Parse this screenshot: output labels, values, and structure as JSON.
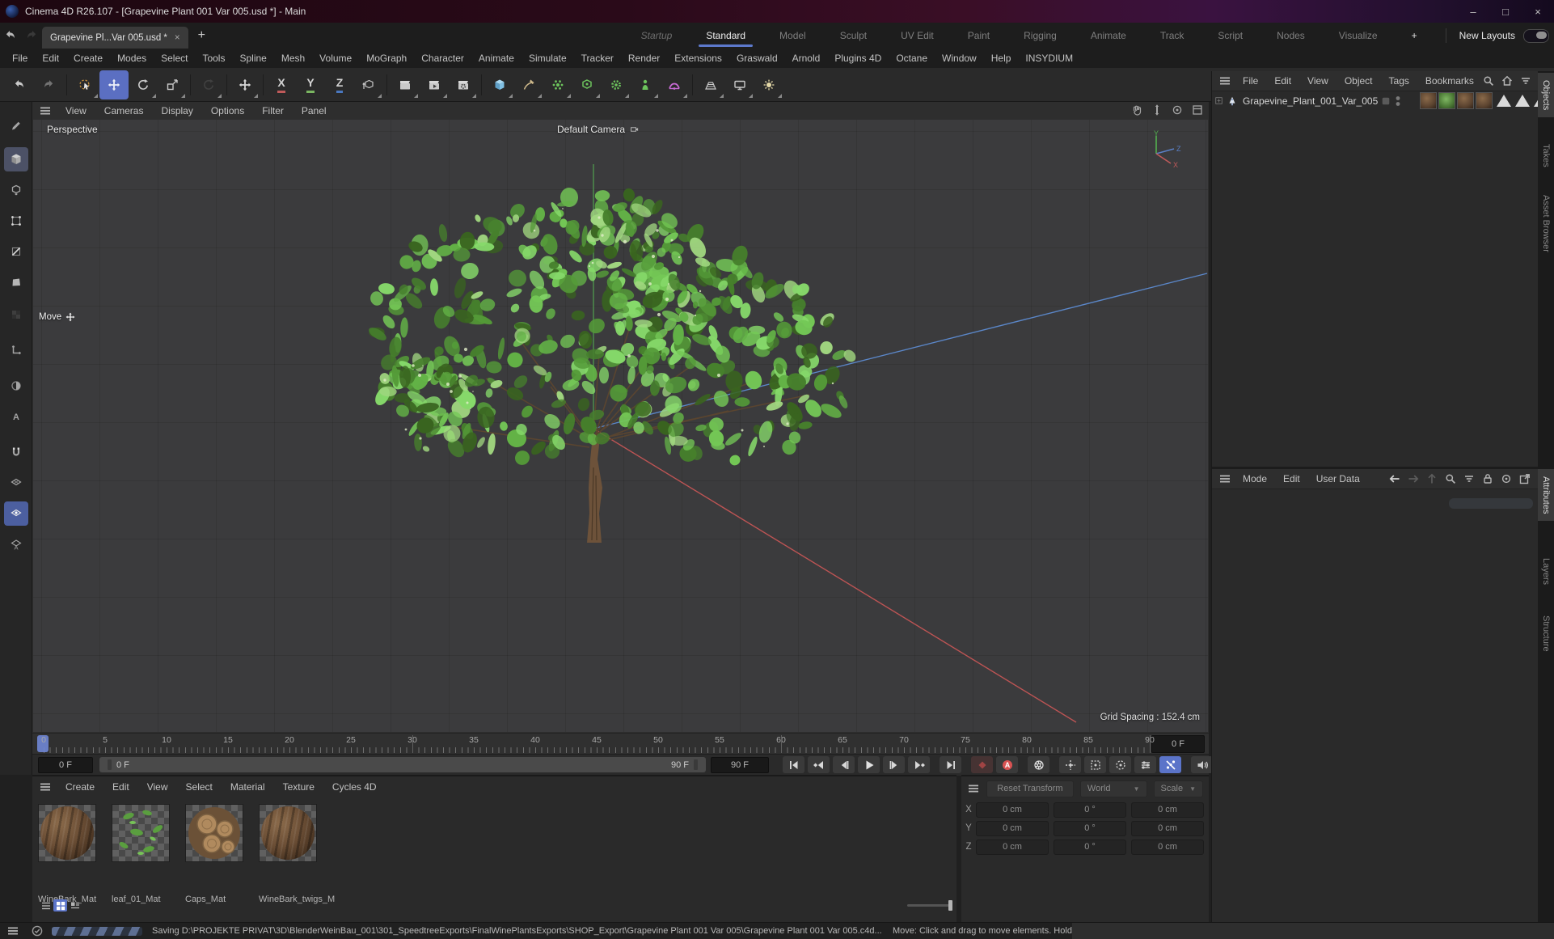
{
  "window": {
    "title": "Cinema 4D R26.107 - [Grapevine Plant 001 Var 005.usd *] - Main",
    "controls": {
      "minimize": "–",
      "maximize": "□",
      "close": "×"
    }
  },
  "document_tabs": {
    "active_tab": "Grapevine Pl...Var 005.usd *",
    "close_glyph": "×",
    "add_tab": "+"
  },
  "layout_tabs": {
    "items": [
      "Startup",
      "Standard",
      "Model",
      "Sculpt",
      "UV Edit",
      "Paint",
      "Rigging",
      "Animate",
      "Track",
      "Script",
      "Nodes",
      "Visualize"
    ],
    "active": "Standard",
    "italic": "Startup",
    "add_button": "+",
    "new_layouts_label": "New Layouts"
  },
  "menu_bar": [
    "File",
    "Edit",
    "Create",
    "Modes",
    "Select",
    "Tools",
    "Spline",
    "Mesh",
    "Volume",
    "MoGraph",
    "Character",
    "Animate",
    "Simulate",
    "Tracker",
    "Render",
    "Extensions",
    "Graswald",
    "Arnold",
    "Plugins 4D",
    "Octane",
    "Window",
    "Help",
    "INSYDIUM"
  ],
  "toolbar": [
    {
      "icon": "undo-icon"
    },
    {
      "icon": "redo-icon",
      "disabled": true
    },
    {
      "icon": "live-selection-icon",
      "sep": true,
      "fly": true
    },
    {
      "icon": "move-tool-icon",
      "active": true
    },
    {
      "icon": "rotate-tool-icon",
      "fly": true
    },
    {
      "icon": "scale-tool-icon",
      "fly": true
    },
    {
      "icon": "last-tool-icon",
      "sep": true,
      "disabled": true,
      "fly": true
    },
    {
      "icon": "axis-modify-icon",
      "sep": true,
      "fly": true
    },
    {
      "icon": "lock-x-icon",
      "sep": true,
      "letter": "X",
      "bar": "#c05a5a"
    },
    {
      "icon": "lock-y-icon",
      "letter": "Y",
      "bar": "#7ab661"
    },
    {
      "icon": "lock-z-icon",
      "letter": "Z",
      "bar": "#4a78c0"
    },
    {
      "icon": "coord-system-icon",
      "fly": true
    },
    {
      "icon": "render-view-icon",
      "sep": true,
      "fly": true
    },
    {
      "icon": "render-picture-viewer-icon",
      "fly": true
    },
    {
      "icon": "render-settings-icon",
      "fly": true
    },
    {
      "icon": "primitive-cube-icon",
      "sep": true,
      "fly": true
    },
    {
      "icon": "spline-pen-icon",
      "fly": true
    },
    {
      "icon": "mograph-icon",
      "fly": true
    },
    {
      "icon": "volume-icon",
      "fly": true
    },
    {
      "icon": "generator-icon",
      "fly": true
    },
    {
      "icon": "deformer-icon",
      "fly": true
    },
    {
      "icon": "field-icon",
      "fly": true
    },
    {
      "icon": "floor-icon",
      "sep": true,
      "fly": true
    },
    {
      "icon": "stage-icon",
      "fly": true
    },
    {
      "icon": "light-icon",
      "fly": true
    }
  ],
  "left_palette": [
    {
      "icon": "tweak-pencil-icon"
    },
    {
      "icon": "model-mode-icon",
      "state": "act-gray"
    },
    {
      "icon": "object-mode-icon"
    },
    {
      "icon": "points-mode-icon"
    },
    {
      "icon": "edges-mode-icon"
    },
    {
      "icon": "polygons-mode-icon"
    },
    {
      "icon": "texture-mode-icon",
      "disabled": true
    },
    {
      "icon": "axis-mode-icon"
    },
    {
      "icon": "solo-mode-icon"
    },
    {
      "icon": "animation-mode-icon"
    },
    {
      "icon": "snap-magnet-icon"
    },
    {
      "icon": "workplane-icon"
    },
    {
      "icon": "snap-grid-icon",
      "state": "act-blue"
    },
    {
      "icon": "quantize-icon"
    }
  ],
  "viewport": {
    "menu": [
      "View",
      "Cameras",
      "Display",
      "Options",
      "Filter",
      "Panel"
    ],
    "nav_icons": [
      "pan-icon",
      "dolly-icon",
      "orbit-icon",
      "maximize-icon"
    ],
    "view_label": "Perspective",
    "camera_label": "Default Camera",
    "tool_hint": "Move",
    "grid_spacing": "Grid Spacing : 152.4 cm",
    "axis_labels": {
      "x": "X",
      "y": "Y",
      "z": "Z"
    }
  },
  "timeline": {
    "tick_start": 0,
    "tick_end": 90,
    "tick_step": 5,
    "current_frame_box": "0 F",
    "frame_field": "0 F",
    "range_start_label": "0 F",
    "range_end_label": "90 F",
    "end_frame_field": "90 F"
  },
  "transport": [
    {
      "icon": "goto-start-icon"
    },
    {
      "icon": "prev-key-icon"
    },
    {
      "icon": "prev-frame-icon"
    },
    {
      "icon": "play-icon"
    },
    {
      "icon": "next-frame-icon"
    },
    {
      "icon": "next-key-icon"
    },
    {
      "icon": "goto-end-icon",
      "gap": true
    },
    {
      "icon": "record-keyframe-icon",
      "gap": true,
      "tint": "dimred"
    },
    {
      "icon": "autokey-icon"
    },
    {
      "icon": "keying-settings-icon",
      "gap": true
    },
    {
      "icon": "key-position-icon",
      "gap": true
    },
    {
      "icon": "key-scale-icon"
    },
    {
      "icon": "key-rotation-icon"
    },
    {
      "icon": "key-parameter-icon"
    },
    {
      "icon": "key-pla-icon",
      "active": true
    },
    {
      "icon": "sound-icon",
      "gap": true
    },
    {
      "icon": "solo-a-icon",
      "active": true
    }
  ],
  "materials": {
    "menu": [
      "Create",
      "Edit",
      "View",
      "Select",
      "Material",
      "Texture",
      "Cycles 4D"
    ],
    "items": [
      {
        "name": "WineBark_Mat",
        "preview": "bark-sphere"
      },
      {
        "name": "leaf_01_Mat",
        "preview": "leaf-scatter"
      },
      {
        "name": "Caps_Mat",
        "preview": "log-caps"
      },
      {
        "name": "WineBark_twigs_M",
        "preview": "bark-sphere"
      }
    ],
    "view_buttons": [
      "list-view-icon",
      "icon-view-icon",
      "detail-view-icon"
    ],
    "active_view": "icon-view-icon"
  },
  "coordinates": {
    "reset_button": "Reset Transform",
    "space_dropdown": "World",
    "mode_dropdown": "Scale",
    "rows": [
      {
        "axis": "X",
        "position": "0 cm",
        "rotation": "0 °",
        "scale": "0 cm"
      },
      {
        "axis": "Y",
        "position": "0 cm",
        "rotation": "0 °",
        "scale": "0 cm"
      },
      {
        "axis": "Z",
        "position": "0 cm",
        "rotation": "0 °",
        "scale": "0 cm"
      }
    ]
  },
  "object_manager": {
    "menu": [
      "File",
      "Edit",
      "View",
      "Object",
      "Tags",
      "Bookmarks"
    ],
    "header_icons": [
      "search-icon",
      "home-icon",
      "filter-icon",
      "external-icon"
    ],
    "object": {
      "name": "Grapevine_Plant_001_Var_005",
      "texture_tags": 4,
      "triangle_tags": 4
    }
  },
  "attributes": {
    "menu": [
      "Mode",
      "Edit",
      "User Data"
    ],
    "header_icons": [
      "back-icon",
      "forward-icon",
      "up-icon",
      "search-icon",
      "filter-icon",
      "lock-icon",
      "track-icon",
      "external-icon"
    ]
  },
  "side_tabs": {
    "top": [
      "Objects",
      "Takes",
      "Asset Browser"
    ],
    "bottom": [
      "Attributes",
      "Layers",
      "Structure"
    ],
    "active_top": "Objects",
    "active_bottom": "Attributes"
  },
  "status_bar": {
    "saving_text": "Saving D:\\PROJEKTE PRIVAT\\3D\\BlenderWeinBau_001\\301_SpeedtreeExports\\FinalWinePlantsExports\\SHOP_Export\\Grapevine Plant 001 Var 005\\Grapevine Plant 001 Var 005.c4d...",
    "hint_text": "Move: Click and drag to move elements. Hold down SHIFT to quantize mo"
  },
  "colors": {
    "accent_blue": "#5d79cc",
    "autokey_red": "#d95252",
    "axis_x": "#c05a5a",
    "axis_y": "#7ab661",
    "axis_z": "#4a78c0",
    "foliage": [
      "#46802c",
      "#549a38",
      "#63b246",
      "#74c856",
      "#86d96a",
      "#39641f",
      "#a0d67f"
    ],
    "trunk": "#6d523a"
  }
}
